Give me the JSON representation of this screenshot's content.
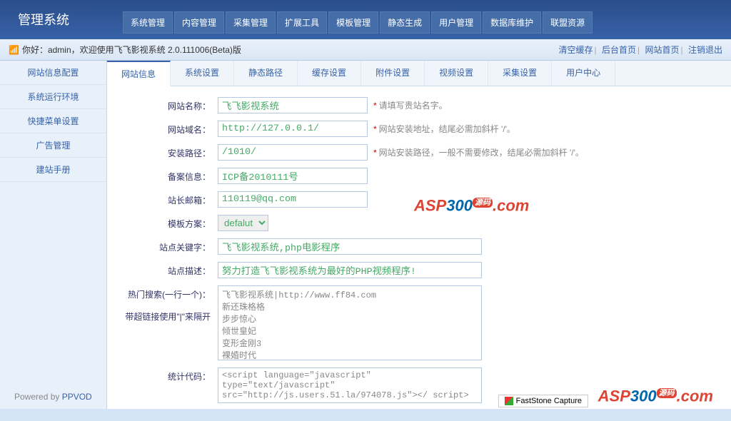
{
  "header": {
    "logo": "管理系统"
  },
  "topnav": [
    "系统管理",
    "内容管理",
    "采集管理",
    "扩展工具",
    "模板管理",
    "静态生成",
    "用户管理",
    "数据库维护",
    "联盟资源"
  ],
  "infobar": {
    "greeting": "你好：admin，欢迎使用飞飞影视系统 2.0.111006(Beta)版",
    "links": [
      "清空缓存",
      "后台首页",
      "网站首页",
      "注销退出"
    ]
  },
  "sidebar": [
    "网站信息配置",
    "系统运行环境",
    "快捷菜单设置",
    "广告管理",
    "建站手册"
  ],
  "powered": {
    "prefix": "Powered by ",
    "name": "PPVOD"
  },
  "tabs": [
    "网站信息",
    "系统设置",
    "静态路径",
    "缓存设置",
    "附件设置",
    "视频设置",
    "采集设置",
    "用户中心"
  ],
  "form": {
    "site_name": {
      "label": "网站名称：",
      "value": "飞飞影视系统",
      "hint": "请填写贵站名字。"
    },
    "site_url": {
      "label": "网站域名：",
      "value": "http://127.0.0.1/",
      "hint": "网站安装地址，结尾必需加斜杆 '/'。"
    },
    "install_path": {
      "label": "安装路径：",
      "value": "/1010/",
      "hint": "网站安装路径，一般不需要修改，结尾必需加斜杆 '/'。"
    },
    "icp": {
      "label": "备案信息：",
      "value": "ICP备2010111号"
    },
    "email": {
      "label": "站长邮箱：",
      "value": "110119@qq.com"
    },
    "template": {
      "label": "模板方案：",
      "value": "defalut"
    },
    "keywords": {
      "label": "站点关键字：",
      "value": "飞飞影视系统,php电影程序"
    },
    "description": {
      "label": "站点描述：",
      "value": "努力打造飞飞影视系统为最好的PHP视频程序!"
    },
    "hotsearch": {
      "label": "热门搜索(一行一个)：",
      "sublabel": "带超链接使用\"|\"来隔开",
      "value": "飞飞影视系统|http://www.ff84.com\n新还珠格格\n步步惊心\n倾世皇妃\n变形金刚3\n裸婚时代\n财神客栈"
    },
    "stats": {
      "label": "统计代码：",
      "value": "<script language=\"javascript\" type=\"text/javascript\" src=\"http://js.users.51.la/974078.js\"></ script>"
    }
  },
  "faststone": "FastStone Capture",
  "watermark": {
    "a": "ASP",
    "b": "300",
    "c": "源码",
    "d": ".com"
  }
}
